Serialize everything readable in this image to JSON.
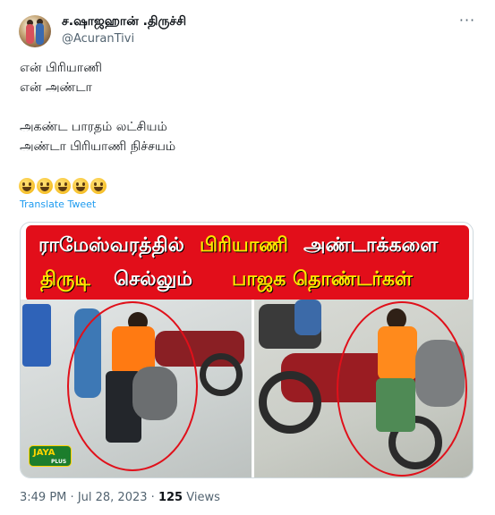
{
  "author": {
    "display_name": "ச.ஷாஜஹான் .திருச்சி",
    "handle": "@AcuranTivi",
    "avatar_icon": "avatar-photo"
  },
  "tweet": {
    "lines": [
      "என் பிரியாணி",
      "என் அண்டா",
      "அகண்ட பாரதம் லட்சியம்",
      "அண்டா பிரியாணி நிச்சயம்"
    ],
    "emoji_icon": "grinning-face-icon",
    "emoji_count": 5,
    "translate_label": "Translate Tweet"
  },
  "media": {
    "caption_line1": [
      "ராமேஸ்வரத்தில்",
      "பிரியாணி",
      "அண்டாக்களை"
    ],
    "caption_line2": [
      "திருடி",
      "செல்லும்",
      "பாஜக தொண்டர்கள்"
    ],
    "logo_text": "JAYA",
    "logo_subtext": "PLUS",
    "colors": {
      "banner": "#e20e1a",
      "caption_white": "#ffffff",
      "caption_yellow": "#ffe600",
      "circle": "#e0101a"
    }
  },
  "footer": {
    "time": "3:49 PM",
    "separator": "·",
    "date": "Jul 28, 2023",
    "views_count": "125",
    "views_label": "Views"
  }
}
